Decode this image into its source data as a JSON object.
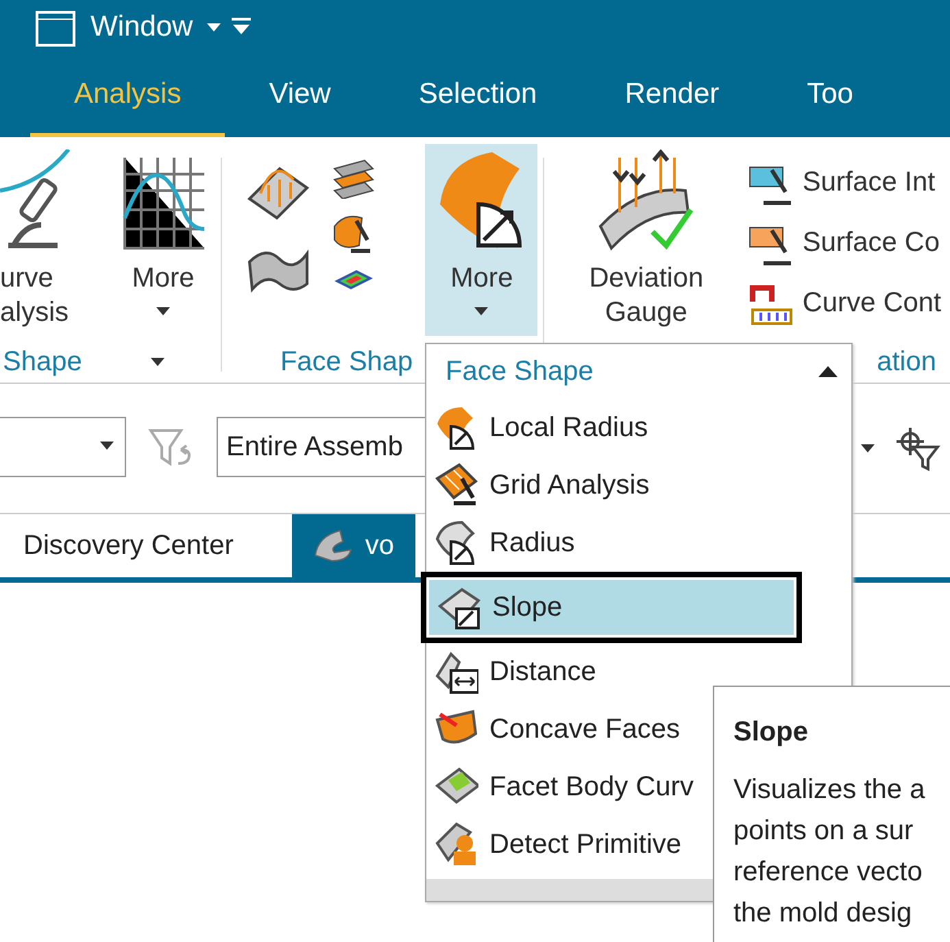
{
  "title_bar": {
    "menu": "Window"
  },
  "tabs": [
    {
      "label": "Analysis",
      "selected": true
    },
    {
      "label": "View",
      "selected": false
    },
    {
      "label": "Selection",
      "selected": false
    },
    {
      "label": "Render",
      "selected": false
    },
    {
      "label": "Too",
      "selected": false
    }
  ],
  "ribbon": {
    "curve_analysis": {
      "label_lines": [
        "urve",
        "alysis"
      ]
    },
    "more_buttons": [
      {
        "label": "More",
        "selected": false
      },
      {
        "label": "More",
        "selected": true
      }
    ],
    "deviation_gauge": {
      "label_lines": [
        "Deviation",
        "Gauge"
      ]
    },
    "small_buttons": [
      "Surface Int",
      "Surface Co",
      "Curve Cont"
    ],
    "group_labels": [
      "Shape",
      "Face Shap",
      "ation"
    ]
  },
  "toolbar": {
    "scope_value": "Entire Assemb"
  },
  "doc_tabs": [
    {
      "label": "Discovery Center",
      "selected": false
    },
    {
      "label": "vo",
      "selected": true
    }
  ],
  "menu": {
    "title": "Face Shape",
    "items": [
      {
        "label": "Local Radius",
        "selected": false,
        "outlined": false
      },
      {
        "label": "Grid Analysis",
        "selected": false,
        "outlined": false
      },
      {
        "label": "Radius",
        "selected": false,
        "outlined": false
      },
      {
        "label": "Slope",
        "selected": true,
        "outlined": true
      },
      {
        "label": "Distance",
        "selected": false,
        "outlined": false
      },
      {
        "label": "Concave Faces",
        "selected": false,
        "outlined": false
      },
      {
        "label": "Facet Body Curv",
        "selected": false,
        "outlined": false
      },
      {
        "label": "Detect Primitive",
        "selected": false,
        "outlined": false
      }
    ]
  },
  "tooltip": {
    "title": "Slope",
    "lines": [
      "Visualizes the a",
      "points on a sur",
      "reference vecto",
      "the mold desig"
    ]
  }
}
